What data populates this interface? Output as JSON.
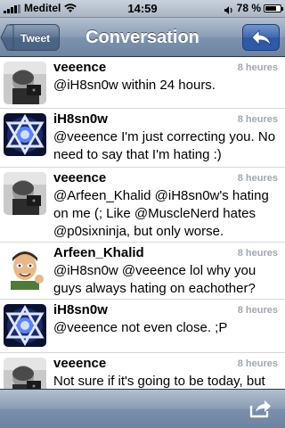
{
  "status_bar": {
    "carrier": "Meditel",
    "time": "14:59",
    "battery_text": "78 %",
    "battery_level": 0.78,
    "icons": [
      "signal-bars-icon",
      "wifi-icon",
      "alarm-icon",
      "battery-icon"
    ]
  },
  "nav": {
    "back_label": "Tweet",
    "title": "Conversation",
    "reply_icon": "reply-arrow-icon"
  },
  "tweets": [
    {
      "user": "veeence",
      "time": "8 heures",
      "text": "@iH8sn0w within 24 hours.",
      "avatar": "veeence"
    },
    {
      "user": "iH8sn0w",
      "time": "8 heures",
      "text": "@veeence I'm just correcting you. No need to say that I'm hating :)",
      "avatar": "ih8sn0w"
    },
    {
      "user": "veeence",
      "time": "8 heures",
      "text": "@Arfeen_Khalid @iH8sn0w's hating on me (; Like @MuscleNerd hates @p0sixninja, but only worse.",
      "avatar": "veeence"
    },
    {
      "user": "Arfeen_Khalid",
      "time": "8 heures",
      "text": "@iH8sn0w @veeence lol why you guys always hating on eachother?",
      "avatar": "arfeen"
    },
    {
      "user": "iH8sn0w",
      "time": "8 heures",
      "text": "@veeence not even close. ;P",
      "avatar": "ih8sn0w"
    },
    {
      "user": "veeence",
      "time": "8 heures",
      "text": "Not sure if it's going to be today, but very soon. Bootstrapping is pretty",
      "avatar": "veeence"
    }
  ],
  "toolbar": {
    "share_icon": "share-icon"
  },
  "colors": {
    "nav_bar": "#7d92ad",
    "reply_button": "#3f68b0",
    "time_text": "#a0a7b3"
  }
}
